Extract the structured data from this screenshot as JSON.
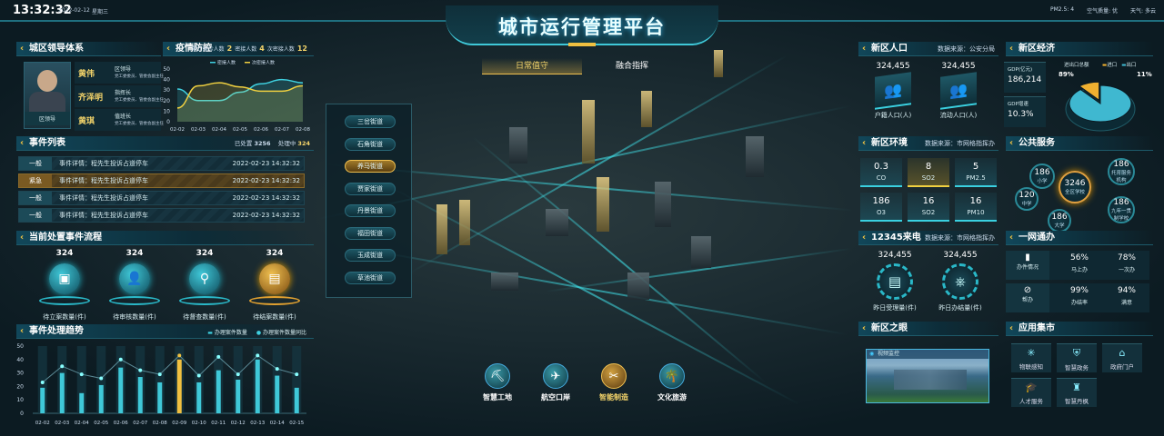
{
  "header": {
    "time": "13:32:32",
    "date": "2022-02-12",
    "weekday": "星期三",
    "title": "城市运行管理平台",
    "pm25": "PM2.5: 4",
    "air": "空气质量: 优",
    "weather": "天气: 多云"
  },
  "tabs": [
    {
      "label": "日常值守",
      "active": true
    },
    {
      "label": "融合指挥",
      "active": false
    }
  ],
  "streets": [
    {
      "label": "三岔街道"
    },
    {
      "label": "石角街道"
    },
    {
      "label": "养马街道",
      "active": true
    },
    {
      "label": "贾家街道"
    },
    {
      "label": "丹景街道"
    },
    {
      "label": "福田街道"
    },
    {
      "label": "玉成街道"
    },
    {
      "label": "草池街道"
    }
  ],
  "bottom_nav": [
    {
      "label": "智慧工地",
      "icon": "construction-icon"
    },
    {
      "label": "航空口岸",
      "icon": "airplane-icon"
    },
    {
      "label": "智能制造",
      "icon": "tools-icon",
      "active": true
    },
    {
      "label": "文化旅游",
      "icon": "palm-tree-icon"
    }
  ],
  "leaders": {
    "title": "城区领导体系",
    "photo_label": "区领导",
    "people": [
      {
        "name": "黄伟",
        "role": "区领导",
        "desc": "党工委委员、管委会副主任"
      },
      {
        "name": "齐泽明",
        "role": "指挥长",
        "desc": "党工委委员、管委会副主任"
      },
      {
        "name": "黄琪",
        "role": "值班长",
        "desc": "党工委委员、管委会副主任"
      }
    ]
  },
  "epidemic": {
    "title": "疫情防控",
    "stats": [
      {
        "label": "累计确诊人数",
        "value": "2"
      },
      {
        "label": "密接人数",
        "value": "4"
      },
      {
        "label": "次密接人数",
        "value": "12"
      }
    ]
  },
  "events": {
    "title": "事件列表",
    "handled_label": "已处置",
    "handled": "3256",
    "processing_label": "处理中",
    "processing": "324",
    "rows": [
      {
        "level": "一般",
        "text": "事件详情：程先生投诉占道停车",
        "time": "2022-02-23 14:32:32"
      },
      {
        "level": "紧急",
        "text": "事件详情：程先生投诉占道停车",
        "time": "2022-02-23 14:32:32",
        "urgent": true
      },
      {
        "level": "一般",
        "text": "事件详情：程先生投诉占道停车",
        "time": "2022-02-23 14:32:32"
      },
      {
        "level": "一般",
        "text": "事件详情：程先生投诉占道停车",
        "time": "2022-02-23 14:32:32"
      }
    ]
  },
  "flow": {
    "title": "当前处置事件流程",
    "items": [
      {
        "value": "324",
        "label": "待立案数量(件)",
        "icon": "id-card-icon"
      },
      {
        "value": "324",
        "label": "待审核数量(件)",
        "icon": "person-icon"
      },
      {
        "value": "324",
        "label": "待督查数量(件)",
        "icon": "inspector-icon"
      },
      {
        "value": "324",
        "label": "待结案数量(件)",
        "icon": "document-icon",
        "gold": true
      }
    ]
  },
  "population": {
    "title": "新区人口",
    "source": "数据来源：公安分局",
    "items": [
      {
        "value": "324,455",
        "label": "户籍人口(人)"
      },
      {
        "value": "324,455",
        "label": "流动人口(人)"
      }
    ]
  },
  "economy": {
    "title": "新区经济",
    "gdp_label": "GDP(亿元)",
    "gdp": "186,214",
    "growth_label": "GDP增速",
    "growth": "10.3%",
    "pie_title": "进出口总额"
  },
  "environment": {
    "title": "新区环境",
    "source": "数据来源：市网格指挥办",
    "items": [
      {
        "value": "0.3",
        "label": "CO"
      },
      {
        "value": "8",
        "label": "SO2",
        "highlight": true
      },
      {
        "value": "5",
        "label": "PM2.5"
      },
      {
        "value": "186",
        "label": "O3"
      },
      {
        "value": "16",
        "label": "SO2"
      },
      {
        "value": "16",
        "label": "PM10"
      }
    ]
  },
  "public_service": {
    "title": "公共服务",
    "center": {
      "value": "3246",
      "label": "全区学校"
    },
    "items": [
      {
        "value": "186",
        "label": "小学"
      },
      {
        "value": "120",
        "label": "中学"
      },
      {
        "value": "186",
        "label": "大学"
      },
      {
        "value": "186",
        "label": "托育服务机构"
      },
      {
        "value": "186",
        "label": "九年一贯制学校"
      }
    ]
  },
  "hotline": {
    "title": "12345来电",
    "source": "数据来源：市网格指挥办",
    "items": [
      {
        "value": "324,455",
        "label": "昨日受理量(件)"
      },
      {
        "value": "324,455",
        "label": "昨日办结量(件)"
      }
    ]
  },
  "gov_service": {
    "title": "一网通办",
    "groups": [
      {
        "label": "办件情况",
        "stats": [
          {
            "value": "56%",
            "label": "马上办"
          },
          {
            "value": "78%",
            "label": "一次办"
          }
        ]
      },
      {
        "label": "帮办",
        "stats": [
          {
            "value": "99%",
            "label": "办结率"
          },
          {
            "value": "94%",
            "label": "满意"
          }
        ]
      }
    ]
  },
  "eye": {
    "title": "新区之眼",
    "video_label": "视频监控"
  },
  "apps": {
    "title": "应用集市",
    "items": [
      {
        "label": "物联感知",
        "icon": "iot-icon"
      },
      {
        "label": "智慧政务",
        "icon": "shield-icon"
      },
      {
        "label": "政府门户",
        "icon": "portal-icon"
      },
      {
        "label": "人才服务",
        "icon": "graduation-icon"
      },
      {
        "label": "智慧丹枫",
        "icon": "building-icon"
      }
    ]
  },
  "colors": {
    "cyan": "#3fd0e0",
    "gold": "#f0c040",
    "bg": "#0b1a22"
  },
  "chart_data": [
    {
      "type": "line",
      "title": "疫情防控",
      "categories": [
        "02-02",
        "02-03",
        "02-04",
        "02-05",
        "02-06",
        "02-07",
        "02-08"
      ],
      "ylim": [
        0,
        50
      ],
      "yticks": [
        0,
        10,
        20,
        30,
        40,
        50
      ],
      "series": [
        {
          "name": "密接人数",
          "color": "#3fd0e0",
          "values": [
            31,
            20,
            20,
            28,
            36,
            40,
            37
          ]
        },
        {
          "name": "次密接人数",
          "color": "#f0d040",
          "values": [
            13,
            34,
            37,
            33,
            29,
            29,
            34
          ]
        }
      ],
      "legend": "top"
    },
    {
      "type": "bar",
      "title": "事件处理趋势",
      "categories": [
        "02-02",
        "02-03",
        "02-04",
        "02-05",
        "02-06",
        "02-07",
        "02-08",
        "02-09",
        "02-10",
        "02-11",
        "02-12",
        "02-13",
        "02-14",
        "02-15"
      ],
      "ylim": [
        0,
        50
      ],
      "yticks": [
        0,
        10,
        20,
        30,
        40,
        50
      ],
      "series": [
        {
          "name": "办理案件数量",
          "type": "bar",
          "values": [
            19,
            30,
            15,
            21,
            34,
            27,
            23,
            40,
            23,
            32,
            25,
            40,
            28,
            19
          ],
          "highlight_index": 7
        },
        {
          "name": "办理案件数量同比",
          "type": "line",
          "values": [
            23,
            35,
            29,
            26,
            40,
            32,
            29,
            43,
            28,
            42,
            29,
            43,
            33,
            29
          ]
        }
      ],
      "legend": "top-right"
    },
    {
      "type": "pie",
      "title": "进出口总额",
      "slices": [
        {
          "name": "出口",
          "value": 89,
          "label": "89%",
          "color": "#3fb8d0"
        },
        {
          "name": "进口",
          "value": 11,
          "label": "11%",
          "color": "#f0b030"
        }
      ],
      "legend_order": [
        "进口",
        "出口"
      ],
      "legend": "top-right"
    }
  ]
}
